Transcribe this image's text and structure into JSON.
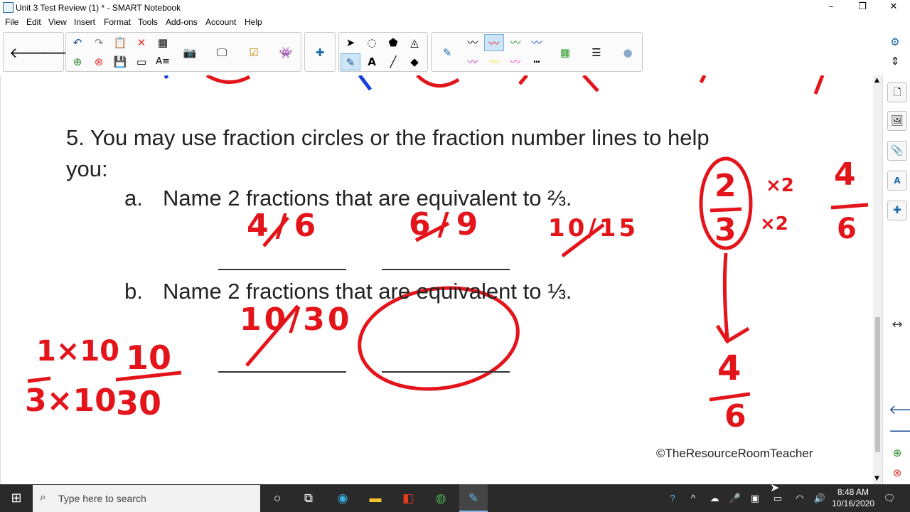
{
  "window": {
    "title": "Unit 3 Test Review (1) * - SMART Notebook",
    "minimize": "–",
    "maximize": "❐",
    "close": "✕"
  },
  "menu": [
    "File",
    "Edit",
    "View",
    "Insert",
    "Format",
    "Tools",
    "Add-ons",
    "Account",
    "Help"
  ],
  "document": {
    "question": "5. You may use fraction circles or the fraction number lines to help",
    "question_cont": "you:",
    "part_a_letter": "a.",
    "part_a_text": "Name 2 fractions that are equivalent to ⅔.",
    "part_b_letter": "b.",
    "part_b_text": "Name 2 fractions that are equivalent to ⅓.",
    "copyright": "©TheResourceRoomTeacher"
  },
  "ink": {
    "a_answer1": "4/6",
    "a_answer2": "6/9",
    "a_extra": "10/15",
    "b_answer1": "10/30",
    "work_top_left": "1×10",
    "work_top_right": "10",
    "work_bottom_left": "3×10",
    "work_bottom_right": "30",
    "right_num": "2",
    "right_den": "3",
    "right_mult_top": "×2",
    "right_mult_bot": "×2",
    "right_result_num": "4",
    "right_result_den": "6",
    "arrow_result_num": "4",
    "arrow_result_den": "6"
  },
  "colors": {
    "ink_red": "#e4141b",
    "ink_blue": "#1a3fd6",
    "accent": "#1e90d6",
    "taskbar": "#2a2a2a"
  },
  "taskbar": {
    "search_placeholder": "Type here to search",
    "time": "8:48 AM",
    "date": "10/16/2020"
  }
}
